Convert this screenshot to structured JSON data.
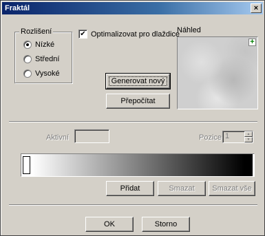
{
  "window": {
    "title": "Fraktál",
    "close_glyph": "×"
  },
  "resolution": {
    "label": "Rozlišení",
    "options": [
      {
        "label": "Nízké",
        "selected": true
      },
      {
        "label": "Střední",
        "selected": false
      },
      {
        "label": "Vysoké",
        "selected": false
      }
    ]
  },
  "optimize": {
    "label": "Optimalizovat pro dlaždice",
    "checked": true,
    "check_glyph": "✔"
  },
  "preview": {
    "label": "Náhled",
    "plus_glyph": "+"
  },
  "buttons": {
    "generate": "Generovat nový",
    "recalc": "Přepočítat",
    "add": "Přidat",
    "delete": "Smazat",
    "delete_all": "Smazat vše",
    "ok": "OK",
    "cancel": "Storno"
  },
  "color_stop": {
    "active_label": "Aktivní",
    "position_label": "Pozice",
    "position_value": "1"
  },
  "gradient": {
    "start_color": "#ffffff",
    "mid_color": "#808080",
    "end_color": "#000000"
  },
  "colors": {
    "face": "#d4d0c8",
    "title_start": "#0a246a",
    "title_end": "#a6caf0",
    "plus_green": "#008000"
  }
}
